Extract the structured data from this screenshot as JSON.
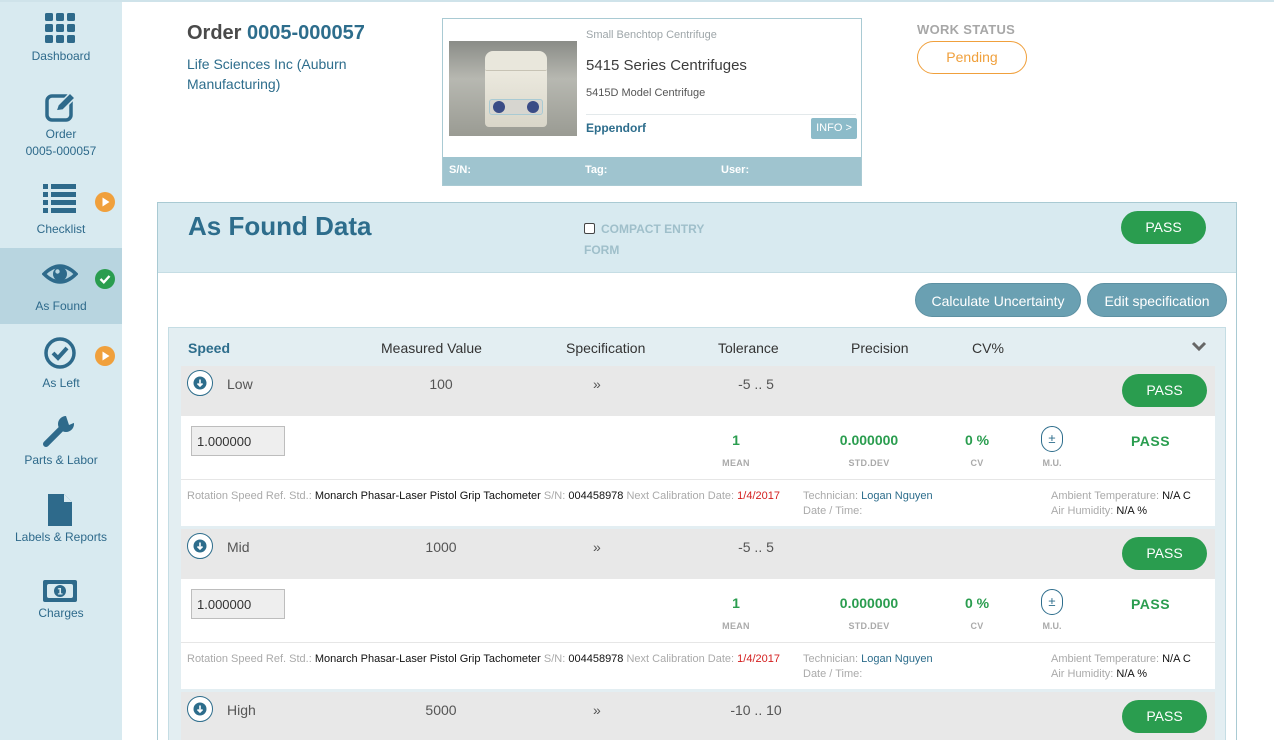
{
  "sidebar": {
    "items": [
      {
        "label": "Dashboard",
        "icon": "dashboard-grid-icon"
      },
      {
        "label": "Order",
        "sub": "0005-000057",
        "icon": "edit-icon"
      },
      {
        "label": "Checklist",
        "icon": "checklist-icon",
        "badge": "play-arrow-icon"
      },
      {
        "label": "As Found",
        "icon": "eye-icon",
        "badge": "check-icon"
      },
      {
        "label": "As Left",
        "icon": "check-circle-icon",
        "badge": "play-arrow-icon"
      },
      {
        "label": "Parts & Labor",
        "icon": "wrench-icon"
      },
      {
        "label": "Labels & Reports",
        "icon": "document-icon"
      },
      {
        "label": "Charges",
        "icon": "money-icon"
      }
    ]
  },
  "header": {
    "order_prefix": "Order",
    "order_number": "0005-000057",
    "customer": "Life Sciences Inc (Auburn Manufacturing)"
  },
  "device": {
    "category": "Small Benchtop Centrifuge",
    "series": "5415 Series Centrifuges",
    "model": "5415D Model Centrifuge",
    "maker": "Eppendorf",
    "info_label": "INFO >",
    "sn_label": "S/N:",
    "tag_label": "Tag:",
    "user_label": "User:"
  },
  "work_status": {
    "label": "WORK STATUS",
    "value": "Pending"
  },
  "panel": {
    "title": "As Found Data",
    "compact_label": "COMPACT ENTRY FORM",
    "pass_label": "PASS",
    "calc_label": "Calculate Uncertainty",
    "edit_label": "Edit specification"
  },
  "columns": {
    "speed": "Speed",
    "measured": "Measured Value",
    "specification": "Specification",
    "tolerance": "Tolerance",
    "precision": "Precision",
    "cv": "CV%"
  },
  "rows": [
    {
      "name": "Low",
      "measured": "100",
      "spec": "»",
      "tolerance": "-5 .. 5",
      "pass": "PASS",
      "entry": "1.000000",
      "mean": "1",
      "stddev": "0.000000",
      "cv": "0 %",
      "result": "PASS",
      "meta": {
        "ref_label": "Rotation Speed Ref. Std.:",
        "ref_value": "Monarch Phasar-Laser Pistol Grip Tachometer",
        "sn_label": "S/N:",
        "sn_value": "004458978",
        "cal_label": "Next Calibration Date:",
        "cal_value": "1/4/2017",
        "tech_label": "Technician:",
        "tech_value": "Logan Nguyen",
        "dt_label": "Date / Time:",
        "temp_label": "Ambient Temperature:",
        "temp_value": "N/A C",
        "hum_label": "Air Humidity:",
        "hum_value": "N/A %"
      }
    },
    {
      "name": "Mid",
      "measured": "1000",
      "spec": "»",
      "tolerance": "-5 .. 5",
      "pass": "PASS",
      "entry": "1.000000",
      "mean": "1",
      "stddev": "0.000000",
      "cv": "0 %",
      "result": "PASS",
      "meta": {
        "ref_label": "Rotation Speed Ref. Std.:",
        "ref_value": "Monarch Phasar-Laser Pistol Grip Tachometer",
        "sn_label": "S/N:",
        "sn_value": "004458978",
        "cal_label": "Next Calibration Date:",
        "cal_value": "1/4/2017",
        "tech_label": "Technician:",
        "tech_value": "Logan Nguyen",
        "dt_label": "Date / Time:",
        "temp_label": "Ambient Temperature:",
        "temp_value": "N/A C",
        "hum_label": "Air Humidity:",
        "hum_value": "N/A %"
      }
    },
    {
      "name": "High",
      "measured": "5000",
      "spec": "»",
      "tolerance": "-10 .. 10",
      "pass": "PASS"
    }
  ],
  "stat_labels": {
    "mean": "MEAN",
    "stddev": "STD.DEV",
    "cv": "CV",
    "mu": "M.U.",
    "mu_symbol": "±"
  },
  "colors": {
    "primary": "#2d6d8c",
    "pass": "#2a9d4f",
    "pending": "#f0a03c",
    "sidebar": "#d8eaf0"
  }
}
